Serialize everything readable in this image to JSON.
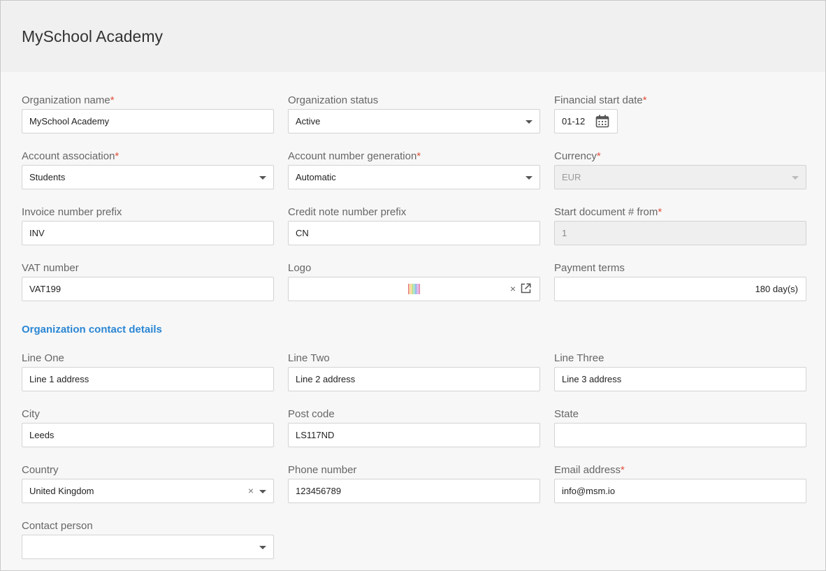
{
  "header": {
    "title": "MySchool Academy"
  },
  "form": {
    "org_name": {
      "label": "Organization name",
      "required": "*",
      "value": "MySchool Academy"
    },
    "org_status": {
      "label": "Organization status",
      "value": "Active"
    },
    "fin_start": {
      "label": "Financial start date",
      "required": "*",
      "value": "01-12"
    },
    "account_assoc": {
      "label": "Account association",
      "required": "*",
      "value": "Students"
    },
    "acc_num_gen": {
      "label": "Account number generation",
      "required": "*",
      "value": "Automatic"
    },
    "currency": {
      "label": "Currency",
      "required": "*",
      "value": "EUR"
    },
    "invoice_prefix": {
      "label": "Invoice number prefix",
      "value": "INV"
    },
    "credit_prefix": {
      "label": "Credit note number prefix",
      "value": "CN"
    },
    "start_doc": {
      "label": "Start document # from",
      "required": "*",
      "value": "1"
    },
    "vat": {
      "label": "VAT number",
      "value": "VAT199"
    },
    "logo": {
      "label": "Logo",
      "clear": "×"
    },
    "payment_terms": {
      "label": "Payment terms",
      "value": "180 day(s)"
    }
  },
  "contact": {
    "section_title": "Organization contact details",
    "line_one": {
      "label": "Line One",
      "value": "Line 1 address"
    },
    "line_two": {
      "label": "Line Two",
      "value": "Line 2 address"
    },
    "line_three": {
      "label": "Line Three",
      "value": "Line 3 address"
    },
    "city": {
      "label": "City",
      "value": "Leeds"
    },
    "post_code": {
      "label": "Post code",
      "value": "LS117ND"
    },
    "state": {
      "label": "State",
      "value": ""
    },
    "country": {
      "label": "Country",
      "value": "United Kingdom",
      "clear": "×"
    },
    "phone": {
      "label": "Phone number",
      "value": "123456789"
    },
    "email": {
      "label": "Email address",
      "required": "*",
      "value": "info@msm.io"
    },
    "contact_person": {
      "label": "Contact person",
      "value": ""
    }
  },
  "colors": {
    "accent": "#2a86d4",
    "required": "#e0503c",
    "header_bg": "#f0f0f0"
  },
  "icons": {
    "calendar": "calendar-icon",
    "external": "open-external-icon",
    "logo": "logo-image"
  }
}
